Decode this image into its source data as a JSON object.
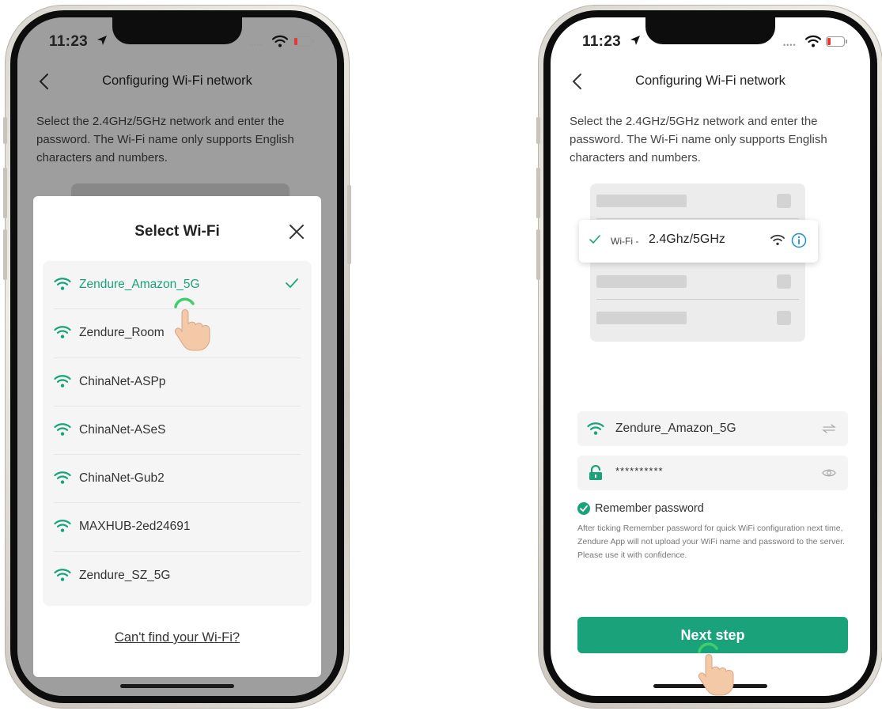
{
  "colors": {
    "accent": "#1aa37a",
    "overlay": "rgba(0,0,0,0.38)",
    "battery_low": "#e53935",
    "info_blue": "#1a8fd6"
  },
  "left_screen": {
    "status_bar": {
      "time": "11:23"
    },
    "nav": {
      "title": "Configuring Wi-Fi network",
      "back_icon": "chevron-left-icon"
    },
    "intro_text": "Select the 2.4GHz/5GHz network and enter the password. The Wi-Fi name only supports English characters and numbers.",
    "sheet": {
      "title": "Select Wi-Fi",
      "close_icon": "close-icon",
      "networks": [
        {
          "name": "Zendure_Amazon_5G",
          "selected": true
        },
        {
          "name": "Zendure_Room",
          "selected": false
        },
        {
          "name": "ChinaNet-ASPp",
          "selected": false
        },
        {
          "name": "ChinaNet-ASeS",
          "selected": false
        },
        {
          "name": "ChinaNet-Gub2",
          "selected": false
        },
        {
          "name": "MAXHUB-2ed24691",
          "selected": false
        },
        {
          "name": "Zendure_SZ_5G",
          "selected": false
        }
      ],
      "link_text": "Can't find your Wi-Fi?"
    }
  },
  "right_screen": {
    "status_bar": {
      "time": "11:23"
    },
    "nav": {
      "title": "Configuring Wi-Fi network",
      "back_icon": "chevron-left-icon"
    },
    "intro_text": "Select the 2.4GHz/5GHz network and enter the password. The Wi-Fi name only supports English characters and numbers.",
    "illustration": {
      "prefix": "Wi-Fi -",
      "band": "2.4Ghz/5GHz"
    },
    "ssid_field": {
      "value": "Zendure_Amazon_5G",
      "icon": "wifi-icon",
      "action_icon": "switch-arrows-icon"
    },
    "password_field": {
      "value": "**********",
      "icon": "lock-icon",
      "action_icon": "eye-icon"
    },
    "remember": {
      "label": "Remember password",
      "checked": true
    },
    "note": "After ticking Remember password for quick WiFi configuration next time, Zendure App will not upload your WiFi name and password to the server. Please use it with confidence.",
    "next_button": "Next step"
  }
}
